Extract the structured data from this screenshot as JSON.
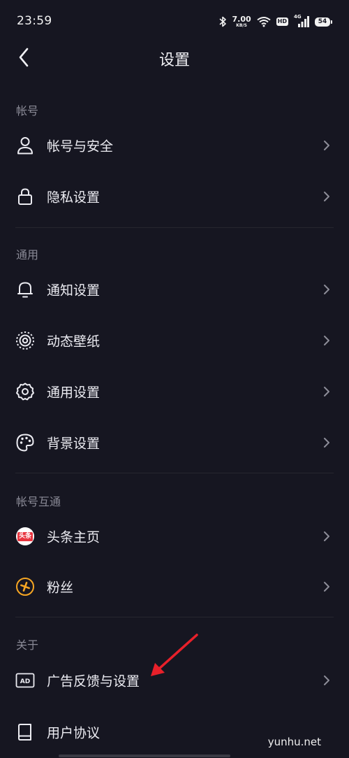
{
  "status_bar": {
    "time": "23:59",
    "net_speed_value": "7.00",
    "net_speed_unit": "KB/S",
    "hd_badge": "HD",
    "network_type": "4G",
    "battery_level": "54",
    "icons": [
      "bluetooth-icon",
      "wifi-icon",
      "hd-icon",
      "signal-icon",
      "battery-icon"
    ]
  },
  "header": {
    "title": "设置",
    "back_icon": "chevron-left-icon"
  },
  "sections": [
    {
      "label": "帐号",
      "items": [
        {
          "label": "帐号与安全",
          "icon": "person-icon"
        },
        {
          "label": "隐私设置",
          "icon": "lock-icon"
        }
      ]
    },
    {
      "label": "通用",
      "items": [
        {
          "label": "通知设置",
          "icon": "bell-icon"
        },
        {
          "label": "动态壁纸",
          "icon": "live-wallpaper-icon"
        },
        {
          "label": "通用设置",
          "icon": "gear-icon"
        },
        {
          "label": "背景设置",
          "icon": "palette-icon"
        }
      ]
    },
    {
      "label": "帐号互通",
      "items": [
        {
          "label": "头条主页",
          "icon": "toutiao-icon",
          "badge_text": "头条"
        },
        {
          "label": "粉丝",
          "icon": "fans-icon"
        }
      ]
    },
    {
      "label": "关于",
      "items": [
        {
          "label": "广告反馈与设置",
          "icon": "ad-icon",
          "badge_text": "AD"
        },
        {
          "label": "用户协议",
          "icon": "book-icon"
        }
      ]
    }
  ],
  "annotation": {
    "icon": "red-arrow-icon",
    "color": "#e8202a"
  },
  "watermark": "yunhu.net",
  "colors": {
    "background": "#161621",
    "text": "#ececf2",
    "section_label": "#8a8a96",
    "chevron": "#8d8d99",
    "toutiao_red": "#e8343f",
    "fans_orange": "#f6a623"
  }
}
